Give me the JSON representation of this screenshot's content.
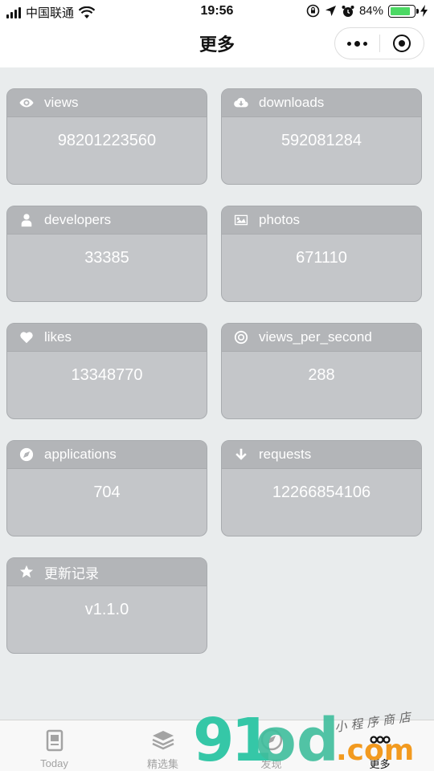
{
  "status_bar": {
    "carrier": "中国联通",
    "time": "19:56",
    "battery": "84%",
    "battery_level": 0.84
  },
  "nav": {
    "title": "更多"
  },
  "cards": [
    {
      "label": "views",
      "value": "98201223560",
      "icon": "eye-icon"
    },
    {
      "label": "downloads",
      "value": "592081284",
      "icon": "cloud-download-icon"
    },
    {
      "label": "developers",
      "value": "33385",
      "icon": "user-icon"
    },
    {
      "label": "photos",
      "value": "671110",
      "icon": "image-icon"
    },
    {
      "label": "likes",
      "value": "13348770",
      "icon": "heart-icon"
    },
    {
      "label": "views_per_second",
      "value": "288",
      "icon": "target-icon"
    },
    {
      "label": "applications",
      "value": "704",
      "icon": "compass-icon"
    },
    {
      "label": "requests",
      "value": "12266854106",
      "icon": "arrow-down-icon"
    },
    {
      "label": "更新记录",
      "value": "v1.1.0",
      "icon": "star-icon"
    }
  ],
  "tabs": [
    {
      "label": "Today",
      "icon": "document-icon"
    },
    {
      "label": "精选集",
      "icon": "layers-icon"
    },
    {
      "label": "发现",
      "icon": "compass-icon"
    },
    {
      "label": "更多",
      "icon": "more-icon"
    }
  ],
  "watermark": {
    "brand_digits": "91",
    "brand_letters": "od",
    "domain_suffix": ".com",
    "slogan": "小程序商店"
  },
  "colors": {
    "card_body": "#c4c6c9",
    "card_header": "#b3b5b8",
    "page_background": "#e9eced",
    "battery_green": "#4cd964",
    "watermark_green": "#35c7a7",
    "watermark_orange": "#f29a1f"
  }
}
